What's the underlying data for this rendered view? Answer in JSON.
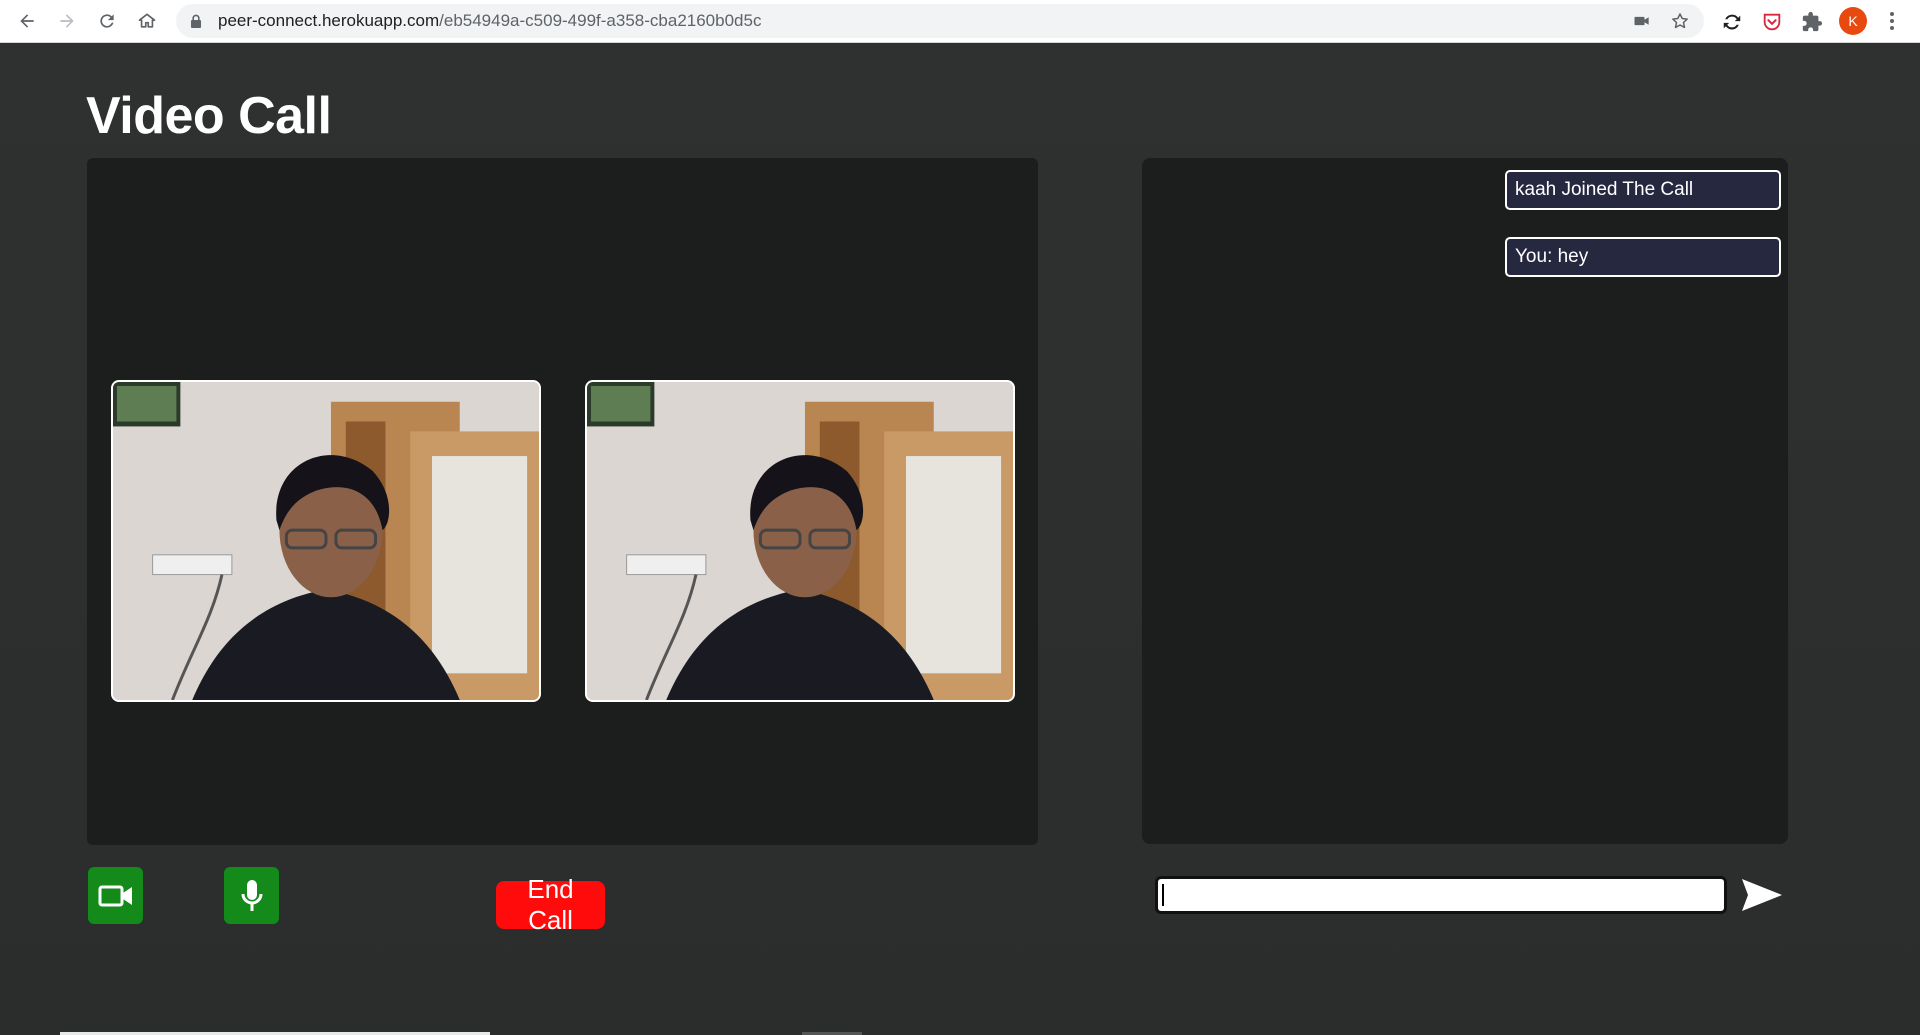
{
  "browser": {
    "url_host": "peer-connect.herokuapp.com",
    "url_path": "/eb54949a-c509-499f-a358-cba2160b0d5c",
    "profile_initial": "K",
    "icons": [
      "back-icon",
      "forward-icon",
      "reload-icon",
      "home-icon",
      "lock-icon",
      "camera-icon",
      "star-icon",
      "sync-icon",
      "pocket-icon",
      "extensions-icon",
      "menu-icon"
    ]
  },
  "page": {
    "title": "Video Call"
  },
  "videos": [
    {
      "label": "local-video"
    },
    {
      "label": "remote-video"
    }
  ],
  "controls": {
    "video_icon": "video-camera-icon",
    "mic_icon": "microphone-icon",
    "end_call_label": "End Call",
    "accent_green": "#138a1a",
    "end_call_color": "#ff0b0b"
  },
  "chat": {
    "messages": [
      "kaah Joined The Call",
      "You: hey"
    ],
    "input_value": "",
    "send_icon": "send-arrow-icon"
  }
}
